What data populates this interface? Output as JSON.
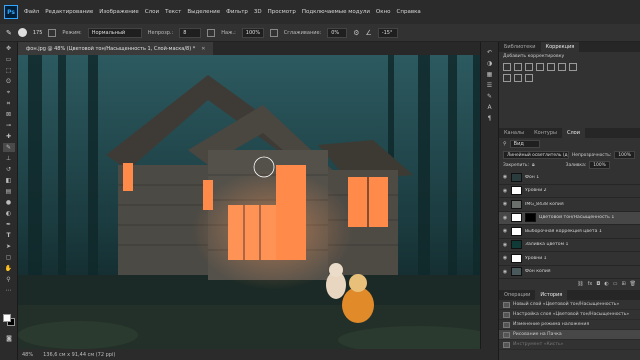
{
  "menubar": {
    "logo": "Ps",
    "items": [
      "Файл",
      "Редактирование",
      "Изображение",
      "Слои",
      "Текст",
      "Выделение",
      "Фильтр",
      "3D",
      "Просмотр",
      "Подключаемые модули",
      "Окно",
      "Справка"
    ]
  },
  "options": {
    "brush_size": "175",
    "mode_label": "Режим:",
    "mode_value": "Нормальный",
    "opacity_label": "Непрозр.:",
    "opacity_value": "8",
    "flow_label": "Наж.:",
    "flow_value": "100%",
    "smooth_label": "Сглаживание:",
    "smooth_value": "0%",
    "angle_value": "-15°"
  },
  "document": {
    "tab_title": "фон.jpg @ 48% (Цветовой тон/Насыщенность 1, Слой-маска/8) *"
  },
  "status": {
    "zoom": "48%",
    "size": "136,6 см x 91,44 см (72 ppi)"
  },
  "panels": {
    "top_tabs": [
      "Библиотеки",
      "Коррекция"
    ],
    "adjust_label": "Добавить корректировку",
    "layer_tabs": [
      "Каналы",
      "Контуры",
      "Слои"
    ],
    "search_placeholder": "Вид",
    "blend_mode": "Линейный осветлитель (добав…",
    "opacity_label": "Непрозрачность:",
    "opacity_value": "100%",
    "lock_label": "Закрепить:",
    "fill_label": "Заливка:",
    "fill_value": "100%"
  },
  "layers": [
    {
      "name": "Фон 1",
      "thumb": "#2a3b3d",
      "selected": false
    },
    {
      "name": "Уровни 2",
      "thumb": "#ffffff",
      "selected": false
    },
    {
      "name": "IMG_8438 копия",
      "thumb": "#6a6f6b",
      "selected": false
    },
    {
      "name": "Цветовой тон/Насыщенность 1",
      "thumb": "#000000",
      "selected": true
    },
    {
      "name": "Выборочная коррекция цвета 1",
      "thumb": "#ffffff",
      "selected": false
    },
    {
      "name": "Заливка цветом 1",
      "thumb": "#0f3a36",
      "selected": false
    },
    {
      "name": "Уровни 1",
      "thumb": "#ffffff",
      "selected": false
    },
    {
      "name": "Фон копия",
      "thumb": "#4a5a5c",
      "selected": false
    }
  ],
  "history": {
    "tabs": [
      "Операции",
      "История"
    ],
    "items": [
      {
        "name": "Новый слой «Цветовой тон/Насыщенность»",
        "selected": false
      },
      {
        "name": "Настройка слоя «Цветовой тон/Насыщенность»",
        "selected": false
      },
      {
        "name": "Изменение режима наложения",
        "selected": false
      },
      {
        "name": "Рисование на Пачка",
        "selected": true
      },
      {
        "name": "Инструмент «Кисть»",
        "selected": false
      }
    ]
  },
  "colors": {
    "accent": "#31a8ff",
    "window_glow": "#ff8a4a",
    "forest": "#1f4448"
  }
}
